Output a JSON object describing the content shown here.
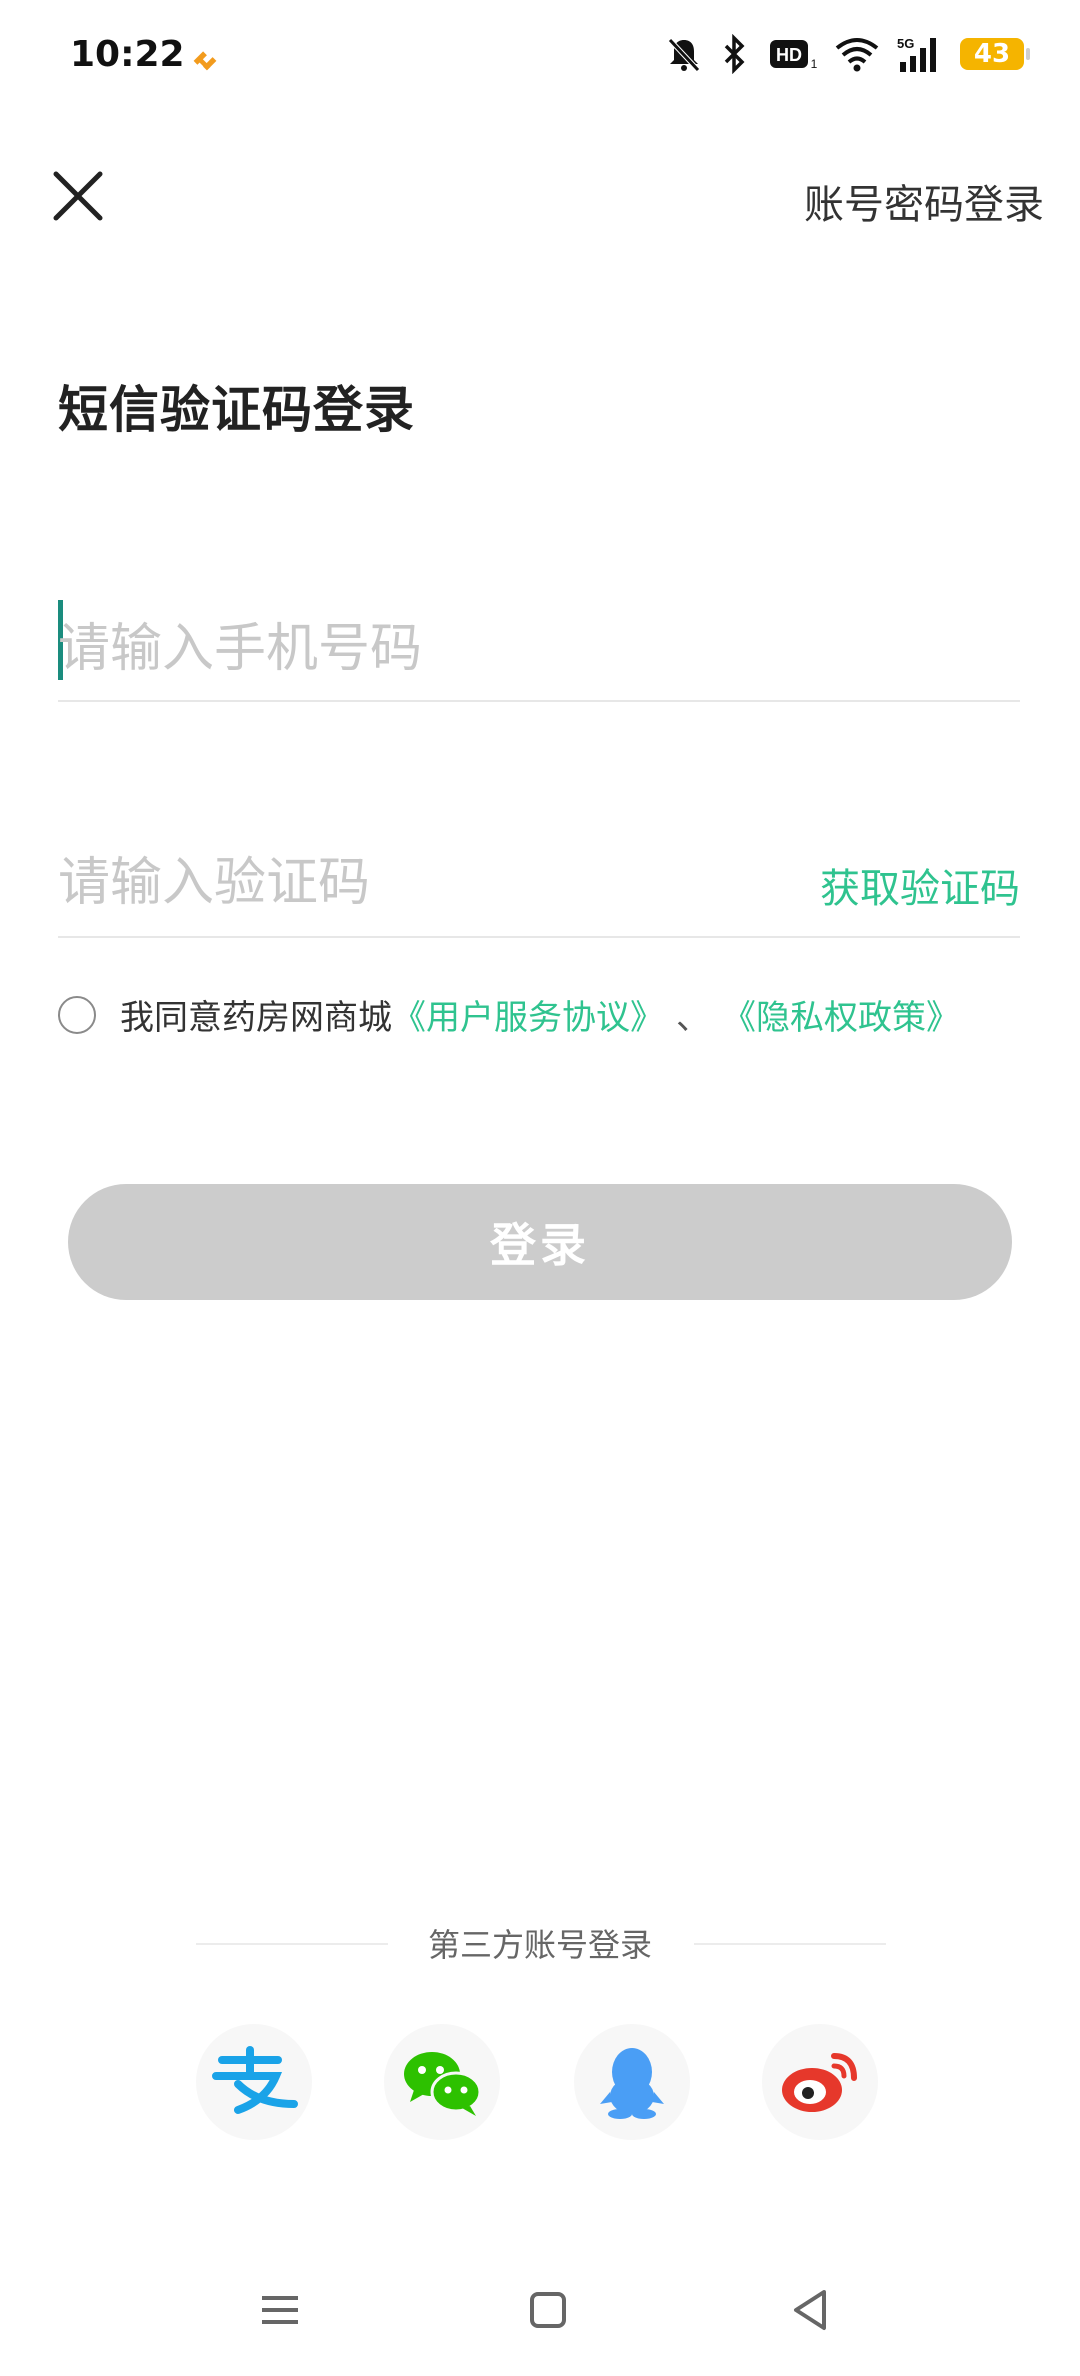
{
  "status_bar": {
    "time": "10:22",
    "battery_level": "43",
    "network": "5G",
    "icons": [
      "mute-bell-icon",
      "bluetooth-icon",
      "hd-icon",
      "wifi-icon",
      "signal-icon",
      "battery-icon"
    ]
  },
  "header": {
    "close_icon": "close-icon",
    "switch_label": "账号密码登录"
  },
  "title": "短信验证码登录",
  "phone_input": {
    "placeholder": "请输入手机号码",
    "value": ""
  },
  "code_input": {
    "placeholder": "请输入验证码",
    "value": ""
  },
  "get_code_label": "获取验证码",
  "agreement": {
    "checked": false,
    "prefix": "我同意药房网商城",
    "terms_link": "《用户服务协议》",
    "separator": "、",
    "privacy_link": "《隐私权政策》"
  },
  "login_button": "登录",
  "third_party": {
    "label": "第三方账号登录",
    "providers": [
      "alipay-icon",
      "wechat-icon",
      "qq-icon",
      "weibo-icon"
    ]
  },
  "colors": {
    "accent": "#2fc38f",
    "caret": "#1a8c7e",
    "login_disabled": "#cccccc",
    "battery": "#f5b400"
  },
  "nav": [
    "menu-icon",
    "home-icon",
    "back-icon"
  ]
}
